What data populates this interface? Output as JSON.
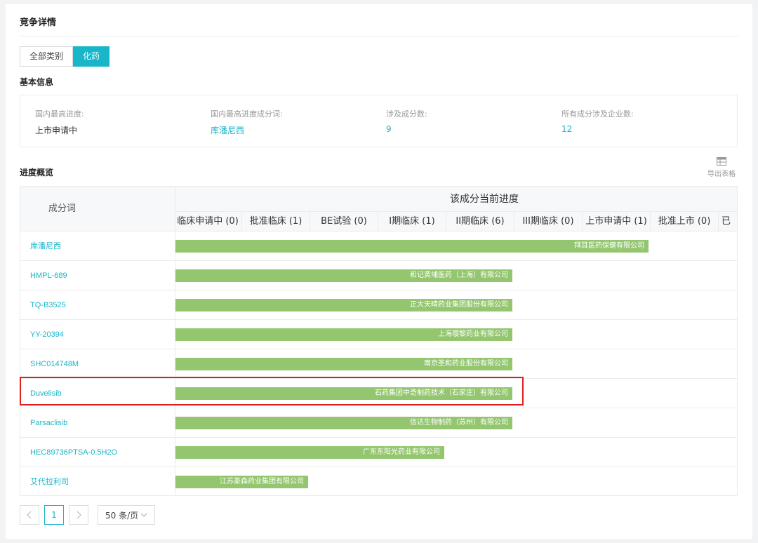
{
  "page": {
    "title": "竞争详情"
  },
  "category_tabs": [
    {
      "label": "全部类别",
      "active": false
    },
    {
      "label": "化药",
      "active": true
    }
  ],
  "basic_info": {
    "section_title": "基本信息",
    "items": [
      {
        "label": "国内最高进度:",
        "value": "上市申请中",
        "is_link": false
      },
      {
        "label": "国内最高进度成分词:",
        "value": "库潘尼西",
        "is_link": true
      },
      {
        "label": "涉及成分数:",
        "value": "9",
        "is_link": true
      },
      {
        "label": "所有成分涉及企业数:",
        "value": "12",
        "is_link": true
      }
    ]
  },
  "progress": {
    "section_title": "进度概览",
    "export_label": "导出表格",
    "column_header": "成分词",
    "progress_header": "该成分当前进度",
    "stages": [
      "临床申请中 (0)",
      "批准临床 (1)",
      "BE试验 (0)",
      "I期临床 (1)",
      "II期临床 (6)",
      "III期临床 (0)",
      "上市申请中 (1)",
      "批准上市 (0)",
      "已"
    ],
    "rows": [
      {
        "name": "库潘尼西",
        "company": "拜耳医药保健有限公司",
        "stage_index": 6
      },
      {
        "name": "HMPL-689",
        "company": "和记黄埔医药（上海）有限公司",
        "stage_index": 4
      },
      {
        "name": "TQ-B3525",
        "company": "正大天晴药业集团股份有限公司",
        "stage_index": 4
      },
      {
        "name": "YY-20394",
        "company": "上海璎黎药业有限公司",
        "stage_index": 4
      },
      {
        "name": "SHC014748M",
        "company": "南京圣和药业股份有限公司",
        "stage_index": 4
      },
      {
        "name": "Duvelisib",
        "company": "石药集团中奇制药技术（石家庄）有限公司",
        "stage_index": 4
      },
      {
        "name": "Parsaclisib",
        "company": "信达生物制药（苏州）有限公司",
        "stage_index": 4
      },
      {
        "name": "HEC89736PTSA-0.5H2O",
        "company": "广东东阳光药业有限公司",
        "stage_index": 3
      },
      {
        "name": "艾代拉利司",
        "company": "江苏豪森药业集团有限公司",
        "stage_index": 1
      }
    ]
  },
  "pagination": {
    "prev_icon": "chevron-left-icon",
    "next_icon": "chevron-right-icon",
    "current_page": "1",
    "page_size_label": "50 条/页"
  },
  "colors": {
    "accent": "#19b5c8",
    "bar": "#93c66e",
    "highlight": "#e02020"
  }
}
